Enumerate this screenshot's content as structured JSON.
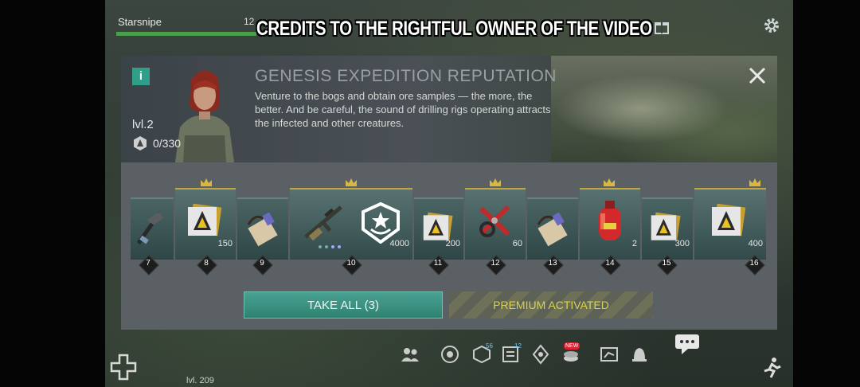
{
  "watermark": "CREDITS TO THE RIGHTFUL OWNER OF THE VIDEO",
  "hud": {
    "player_name": "Starsnipe",
    "player_value": "12",
    "player_level": "lvl. 209"
  },
  "panel": {
    "title": "GENESIS EXPEDITION REPUTATION",
    "description": "Venture to the bogs and obtain ore samples — the more, the better. And be careful, the sound of drilling rigs operating attracts the infected and other creatures.",
    "level": "lvl.2",
    "reputation": "0/330"
  },
  "rewards": [
    {
      "level": "7",
      "item": "hammer-icon",
      "qty": "",
      "premium": false
    },
    {
      "level": "8",
      "item": "token-icon",
      "qty": "150",
      "premium": true
    },
    {
      "level": "9",
      "item": "scroll-icon",
      "qty": "",
      "premium": false
    },
    {
      "level": "10",
      "item": "rifle-icon",
      "qty": "4000",
      "premium": true
    },
    {
      "level": "11",
      "item": "token-icon",
      "qty": "200",
      "premium": false
    },
    {
      "level": "12",
      "item": "pliers-icon",
      "qty": "60",
      "premium": true
    },
    {
      "level": "13",
      "item": "scroll-icon",
      "qty": "",
      "premium": false
    },
    {
      "level": "14",
      "item": "gas-canister-icon",
      "qty": "2",
      "premium": true
    },
    {
      "level": "15",
      "item": "token-icon",
      "qty": "300",
      "premium": false
    },
    {
      "level": "16",
      "item": "token-icon",
      "qty": "400",
      "premium": true
    }
  ],
  "buttons": {
    "take_all": "TAKE ALL (3)",
    "premium": "PREMIUM ACTIVATED"
  },
  "badges": {
    "b1": "56",
    "b2": "12",
    "new": "NEW"
  },
  "colors": {
    "accent": "#2f9f8a",
    "premium_text": "#d7d34a",
    "crown": "#d8b840"
  }
}
